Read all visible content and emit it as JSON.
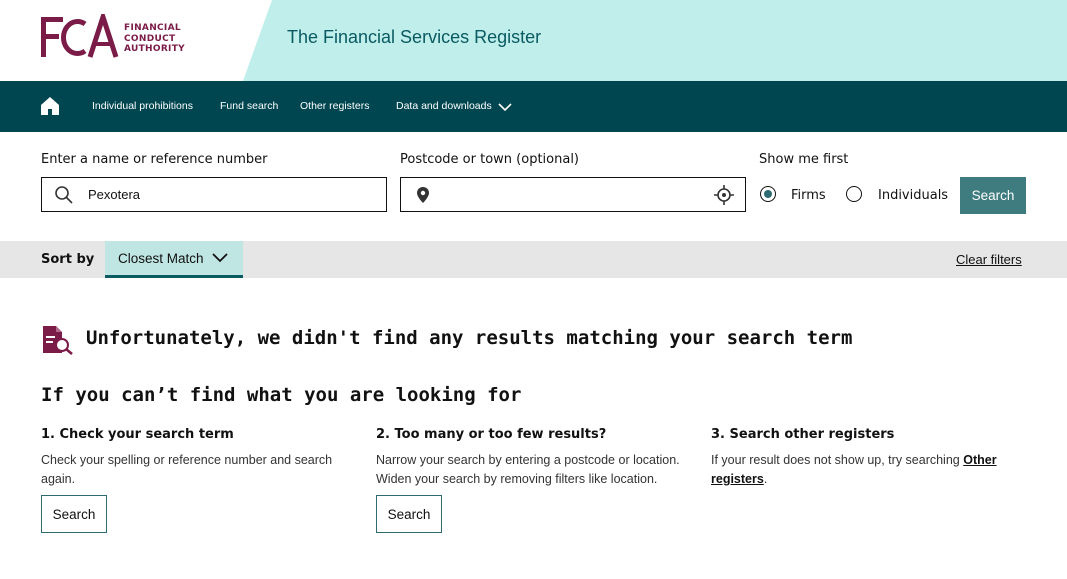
{
  "brand": {
    "logo_letters": "FCA",
    "logo_lines": [
      "FINANCIAL",
      "CONDUCT",
      "AUTHORITY"
    ],
    "site_title": "The Financial Services Register",
    "primary_color": "#7b1b48",
    "accent_band_color": "#bfeeeb",
    "nav_color": "#004650"
  },
  "nav": {
    "home_icon": "home-icon",
    "items": [
      "Individual prohibitions",
      "Fund search",
      "Other registers",
      "Data and downloads"
    ]
  },
  "search": {
    "name_label": "Enter a name or reference number",
    "name_value": "Pexotera",
    "postcode_label": "Postcode or town (optional)",
    "postcode_value": "",
    "show_first_label": "Show me first",
    "options": [
      "Firms",
      "Individuals"
    ],
    "selected_option": "Firms",
    "button_label": "Search"
  },
  "sort": {
    "label": "Sort by",
    "selected": "Closest Match",
    "clear_filters": "Clear filters"
  },
  "results": {
    "no_results_message": "Unfortunately, we didn't find any results matching your search term",
    "help_heading": "If you can’t find what you are looking for",
    "columns": [
      {
        "title": "1. Check your search term",
        "text": "Check your spelling or reference number and search again.",
        "button": "Search"
      },
      {
        "title": "2. Too many or too few results?",
        "text": "Narrow your search by entering a postcode or location. Widen your search by removing filters like location.",
        "button": "Search"
      },
      {
        "title": "3. Search other registers",
        "text_before": "If your result does not show up, try searching ",
        "link": "Other registers",
        "text_after": "."
      }
    ]
  }
}
